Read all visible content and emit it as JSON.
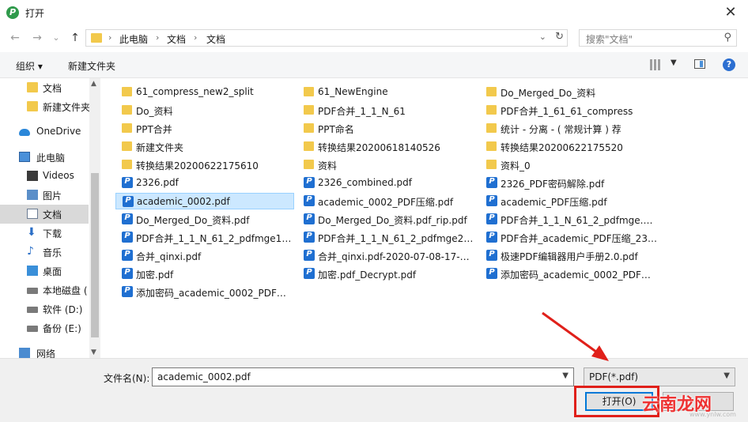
{
  "window": {
    "title": "打开",
    "close_glyph": "✕"
  },
  "nav": {
    "back": "←",
    "forward": "→",
    "recent": "⌄",
    "up": "↑",
    "breadcrumbs": [
      "此电脑",
      "文档",
      "文档"
    ],
    "separator": "›",
    "search_placeholder": "搜索\"文档\""
  },
  "toolbar": {
    "organize": "组织 ▾",
    "new_folder": "新建文件夹"
  },
  "sidebar": {
    "items": [
      {
        "label": "文档",
        "icon": "folder-icon"
      },
      {
        "label": "新建文件夹",
        "icon": "folder-icon"
      },
      {
        "label": "OneDrive",
        "icon": "cloud-icon"
      },
      {
        "label": "此电脑",
        "icon": "pc-icon"
      },
      {
        "label": "Videos",
        "icon": "video-icon"
      },
      {
        "label": "图片",
        "icon": "picture-icon"
      },
      {
        "label": "文档",
        "icon": "document-icon"
      },
      {
        "label": "下载",
        "icon": "download-icon"
      },
      {
        "label": "音乐",
        "icon": "music-icon"
      },
      {
        "label": "桌面",
        "icon": "desktop-icon"
      },
      {
        "label": "本地磁盘 (",
        "icon": "disk-icon"
      },
      {
        "label": "软件 (D:)",
        "icon": "disk-icon"
      },
      {
        "label": "备份 (E:)",
        "icon": "disk-icon"
      },
      {
        "label": "网络",
        "icon": "network-icon"
      }
    ]
  },
  "files": [
    {
      "name": "61_compress_new2_split",
      "type": "folder"
    },
    {
      "name": "Do_资料",
      "type": "folder"
    },
    {
      "name": "PPT合并",
      "type": "folder"
    },
    {
      "name": "新建文件夹",
      "type": "folder"
    },
    {
      "name": "转换结果20200622175610",
      "type": "folder"
    },
    {
      "name": "2326.pdf",
      "type": "pdf"
    },
    {
      "name": "academic_0002.pdf",
      "type": "pdf",
      "selected": true
    },
    {
      "name": "Do_Merged_Do_资料.pdf",
      "type": "pdf"
    },
    {
      "name": "PDF合并_1_1_N_61_2_pdfmge1_sp...",
      "type": "pdf"
    },
    {
      "name": "合并_qinxi.pdf",
      "type": "pdf"
    },
    {
      "name": "加密.pdf",
      "type": "pdf"
    },
    {
      "name": "添加密码_academic_0002_PDF压缩...",
      "type": "pdf"
    },
    {
      "name": "61_NewEngine",
      "type": "folder"
    },
    {
      "name": "PDF合并_1_1_N_61",
      "type": "folder"
    },
    {
      "name": "PPT命名",
      "type": "folder"
    },
    {
      "name": "转换结果20200618140526",
      "type": "folder"
    },
    {
      "name": "资料",
      "type": "folder"
    },
    {
      "name": "2326_combined.pdf",
      "type": "pdf"
    },
    {
      "name": "academic_0002_PDF压缩.pdf",
      "type": "pdf"
    },
    {
      "name": "Do_Merged_Do_资料.pdf_rip.pdf",
      "type": "pdf"
    },
    {
      "name": "PDF合并_1_1_N_61_2_pdfmge2_sp...",
      "type": "pdf"
    },
    {
      "name": "合并_qinxi.pdf-2020-07-08-17-43-...",
      "type": "pdf"
    },
    {
      "name": "加密.pdf_Decrypt.pdf",
      "type": "pdf"
    },
    {
      "name": "Do_Merged_Do_资料",
      "type": "folder"
    },
    {
      "name": "PDF合并_1_61_61_compress",
      "type": "folder"
    },
    {
      "name": "统计 - 分离 - ( 常规计算 ) 荐",
      "type": "folder"
    },
    {
      "name": "转换结果20200622175520",
      "type": "folder"
    },
    {
      "name": "资料_0",
      "type": "folder"
    },
    {
      "name": "2326_PDF密码解除.pdf",
      "type": "pdf"
    },
    {
      "name": "academic_PDF压缩.pdf",
      "type": "pdf"
    },
    {
      "name": "PDF合并_1_1_N_61_2_pdfmge.pdf",
      "type": "pdf"
    },
    {
      "name": "PDF合并_academic_PDF压缩_2326....",
      "type": "pdf"
    },
    {
      "name": "极速PDF编辑器用户手册2.0.pdf",
      "type": "pdf"
    },
    {
      "name": "添加密码_academic_0002_PDF压缩...",
      "type": "pdf"
    }
  ],
  "bottom": {
    "filename_label": "文件名(N):",
    "filename_value": "academic_0002.pdf",
    "filter_value": "PDF(*.pdf)",
    "open_label": "打开(O)",
    "cancel_label": ""
  },
  "watermark": {
    "text": "云南龙网",
    "site": "www.ynlw.com"
  },
  "colors": {
    "accent": "#0078d7",
    "annotation": "#e0201a"
  }
}
